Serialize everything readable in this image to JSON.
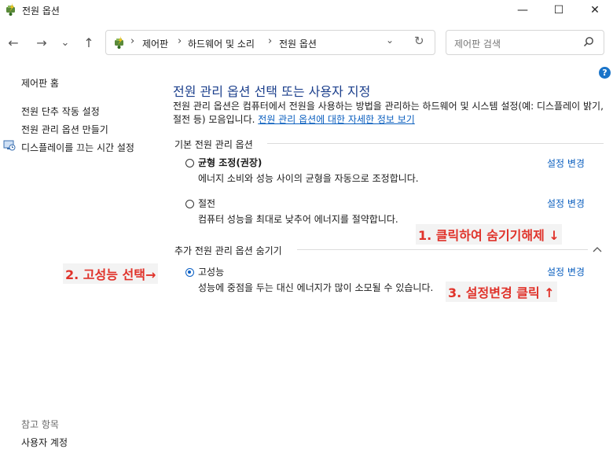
{
  "window": {
    "title": "전원 옵션",
    "minimize_glyph": "—",
    "maximize_glyph": "☐",
    "close_glyph": "✕"
  },
  "nav": {
    "back_glyph": "←",
    "forward_glyph": "→",
    "recent_glyph": "⌄",
    "up_glyph": "↑"
  },
  "address": {
    "crumbs": [
      "제어판",
      "하드웨어 및 소리",
      "전원 옵션"
    ],
    "sep": "›",
    "dropdown_glyph": "⌄",
    "refresh_glyph": "↻"
  },
  "search": {
    "placeholder": "제어판 검색",
    "icon": "search-icon"
  },
  "help": {
    "label": "?"
  },
  "sidebar": {
    "home": "제어판 홈",
    "links": [
      "전원 단추 작동 설정",
      "전원 관리 옵션 만들기",
      "디스플레이를 끄는 시간 설정"
    ],
    "see_also_title": "참고 항목",
    "see_also": [
      "사용자 계정"
    ]
  },
  "main": {
    "title": "전원 관리 옵션 선택 또는 사용자 지정",
    "description": "전원 관리 옵션은 컴퓨터에서 전원을 사용하는 방법을 관리하는 하드웨어 및 시스템 설정(예: 디스플레이 밝기, 절전 등) 모음입니다.",
    "description_link": "전원 관리 옵션에 대한 자세한 정보 보기",
    "basic_group_label": "기본 전원 관리 옵션",
    "extra_group_label": "추가 전원 관리 옵션 숨기기",
    "change_label": "설정 변경",
    "plans": [
      {
        "name": "균형 조정(권장)",
        "desc": "에너지 소비와 성능 사이의 균형을 자동으로 조정합니다.",
        "selected": false
      },
      {
        "name": "절전",
        "desc": "컴퓨터 성능을 최대로 낮추어 에너지를 절약합니다.",
        "selected": false
      },
      {
        "name": "고성능",
        "desc": "성능에 중점을 두는 대신 에너지가 많이 소모될 수 있습니다.",
        "selected": true
      }
    ]
  },
  "annotations": {
    "step1": "1. 클릭하여 숨기기해제 ↓",
    "step2": "2. 고성능 선택→",
    "step3": "3. 설정변경 클릭 ↑",
    "color": "#e0322a"
  },
  "colors": {
    "title_blue": "#1b3f8c",
    "link_blue": "#0b5fbf",
    "radio_selected": "#0a5fc4"
  }
}
